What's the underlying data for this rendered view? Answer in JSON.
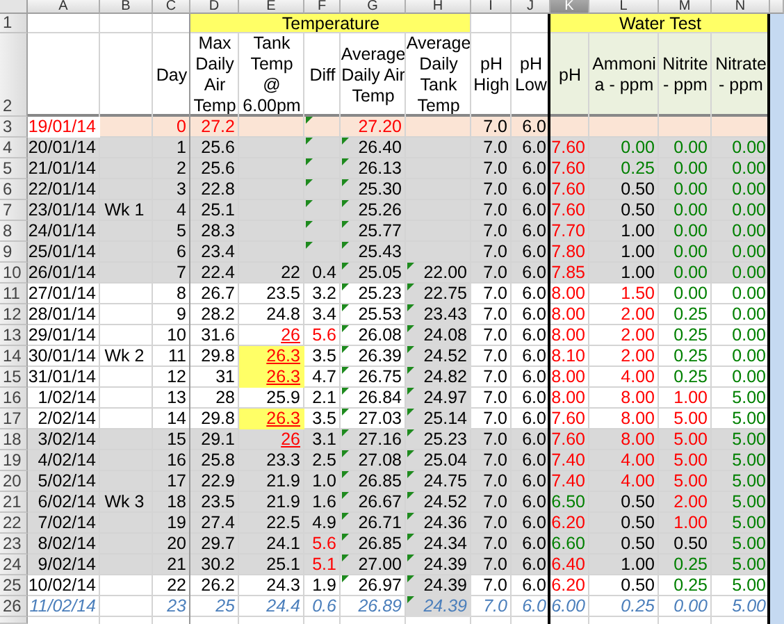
{
  "columns": [
    {
      "letter": "A",
      "selected": false,
      "shaded": false
    },
    {
      "letter": "B",
      "selected": false,
      "shaded": false
    },
    {
      "letter": "C",
      "selected": false,
      "shaded": false
    },
    {
      "letter": "D",
      "selected": false,
      "shaded": false
    },
    {
      "letter": "E",
      "selected": false,
      "shaded": false
    },
    {
      "letter": "F",
      "selected": false,
      "shaded": false
    },
    {
      "letter": "G",
      "selected": false,
      "shaded": false
    },
    {
      "letter": "H",
      "selected": false,
      "shaded": true
    },
    {
      "letter": "I",
      "selected": false,
      "shaded": false
    },
    {
      "letter": "J",
      "selected": false,
      "shaded": false
    },
    {
      "letter": "K",
      "selected": true,
      "shaded": false
    },
    {
      "letter": "L",
      "selected": false,
      "shaded": false
    },
    {
      "letter": "M",
      "selected": false,
      "shaded": false
    },
    {
      "letter": "N",
      "selected": false,
      "shaded": false
    }
  ],
  "header_rows": [
    "1",
    "2"
  ],
  "group_headers": [
    {
      "text": "Temperature"
    },
    {
      "text": "Water Test"
    }
  ],
  "headers": [
    {
      "text": "Day"
    },
    {
      "text": "Max Daily Air Temp"
    },
    {
      "text": "Tank Temp @ 6.00pm"
    },
    {
      "text": "Diff"
    },
    {
      "text": "Average Daily Air Temp"
    },
    {
      "text": "Average Daily Tank Temp"
    },
    {
      "text": "pH High"
    },
    {
      "text": "pH Low"
    },
    {
      "text": "pH"
    },
    {
      "text": "Ammoni a - ppm"
    },
    {
      "text": "Nitrite - ppm"
    },
    {
      "text": "Nitrate - ppm"
    }
  ],
  "rows": [
    {
      "number": "3",
      "kind": "baseline",
      "italic": false,
      "cells": [
        {
          "text": "19/01/14",
          "color": "#ff0000",
          "flag": false
        },
        {
          "flag": false
        },
        {
          "text": "0",
          "color": "#ff0000",
          "flag": false
        },
        {
          "text": "27.2",
          "color": "#ff0000",
          "flag": false
        },
        {
          "flag": false
        },
        {
          "flag": true
        },
        {
          "text": "27.20",
          "color": "#ff0000",
          "flag": false
        },
        {
          "flag": false
        },
        {
          "text": "7.0",
          "flag": false
        },
        {
          "text": "6.0",
          "flag": false
        },
        {
          "flag": false
        },
        {
          "flag": false
        },
        {
          "flag": false
        },
        {
          "flag": false
        }
      ]
    },
    {
      "number": "4",
      "kind": "shaded",
      "italic": false,
      "cells": [
        {
          "text": "20/01/14",
          "flag": false
        },
        {
          "flag": false
        },
        {
          "text": "1",
          "flag": false
        },
        {
          "text": "25.6",
          "flag": false
        },
        {
          "flag": false
        },
        {
          "flag": true
        },
        {
          "text": "26.40",
          "flag": true
        },
        {
          "flag": false
        },
        {
          "text": "7.0",
          "flag": false
        },
        {
          "text": "6.0",
          "flag": false
        },
        {
          "text": "7.60",
          "color": "#ff0000",
          "flag": false
        },
        {
          "text": "0.00",
          "color": "#008000",
          "flag": false
        },
        {
          "text": "0.00",
          "color": "#008000",
          "flag": false
        },
        {
          "text": "0.00",
          "color": "#008000",
          "flag": false
        }
      ]
    },
    {
      "number": "5",
      "kind": "shaded",
      "italic": false,
      "cells": [
        {
          "text": "21/01/14",
          "flag": false
        },
        {
          "flag": false
        },
        {
          "text": "2",
          "flag": false
        },
        {
          "text": "25.6",
          "flag": false
        },
        {
          "flag": false
        },
        {
          "flag": true
        },
        {
          "text": "26.13",
          "flag": true
        },
        {
          "flag": false
        },
        {
          "text": "7.0",
          "flag": false
        },
        {
          "text": "6.0",
          "flag": false
        },
        {
          "text": "7.60",
          "color": "#ff0000",
          "flag": false
        },
        {
          "text": "0.25",
          "color": "#008000",
          "flag": false
        },
        {
          "text": "0.00",
          "color": "#008000",
          "flag": false
        },
        {
          "text": "0.00",
          "color": "#008000",
          "flag": false
        }
      ]
    },
    {
      "number": "6",
      "kind": "shaded",
      "italic": false,
      "cells": [
        {
          "text": "22/01/14",
          "flag": false
        },
        {
          "flag": false
        },
        {
          "text": "3",
          "flag": false
        },
        {
          "text": "22.8",
          "flag": false
        },
        {
          "flag": false
        },
        {
          "flag": true
        },
        {
          "text": "25.30",
          "flag": true
        },
        {
          "flag": false
        },
        {
          "text": "7.0",
          "flag": false
        },
        {
          "text": "6.0",
          "flag": false
        },
        {
          "text": "7.60",
          "color": "#ff0000",
          "flag": false
        },
        {
          "text": "0.50",
          "flag": false
        },
        {
          "text": "0.00",
          "color": "#008000",
          "flag": false
        },
        {
          "text": "0.00",
          "color": "#008000",
          "flag": false
        }
      ]
    },
    {
      "number": "7",
      "kind": "shaded",
      "italic": false,
      "cells": [
        {
          "text": "23/01/14",
          "flag": false
        },
        {
          "text": "Wk 1",
          "flag": false
        },
        {
          "text": "4",
          "flag": false
        },
        {
          "text": "25.1",
          "flag": false
        },
        {
          "flag": false
        },
        {
          "flag": true
        },
        {
          "text": "25.26",
          "flag": true
        },
        {
          "flag": false
        },
        {
          "text": "7.0",
          "flag": false
        },
        {
          "text": "6.0",
          "flag": false
        },
        {
          "text": "7.60",
          "color": "#ff0000",
          "flag": false
        },
        {
          "text": "0.50",
          "flag": false
        },
        {
          "text": "0.00",
          "color": "#008000",
          "flag": false
        },
        {
          "text": "0.00",
          "color": "#008000",
          "flag": false
        }
      ]
    },
    {
      "number": "8",
      "kind": "shaded",
      "italic": false,
      "cells": [
        {
          "text": "24/01/14",
          "flag": false
        },
        {
          "flag": false
        },
        {
          "text": "5",
          "flag": false
        },
        {
          "text": "28.3",
          "flag": false
        },
        {
          "flag": false
        },
        {
          "flag": true
        },
        {
          "text": "25.77",
          "flag": true
        },
        {
          "flag": false
        },
        {
          "text": "7.0",
          "flag": false
        },
        {
          "text": "6.0",
          "flag": false
        },
        {
          "text": "7.70",
          "color": "#ff0000",
          "flag": false
        },
        {
          "text": "1.00",
          "flag": false
        },
        {
          "text": "0.00",
          "color": "#008000",
          "flag": false
        },
        {
          "text": "0.00",
          "color": "#008000",
          "flag": false
        }
      ]
    },
    {
      "number": "9",
      "kind": "shaded",
      "italic": false,
      "cells": [
        {
          "text": "25/01/14",
          "flag": false
        },
        {
          "flag": false
        },
        {
          "text": "6",
          "flag": false
        },
        {
          "text": "23.4",
          "flag": false
        },
        {
          "flag": false
        },
        {
          "flag": true
        },
        {
          "text": "25.43",
          "flag": true
        },
        {
          "flag": false
        },
        {
          "text": "7.0",
          "flag": false
        },
        {
          "text": "6.0",
          "flag": false
        },
        {
          "text": "7.80",
          "color": "#ff0000",
          "flag": false
        },
        {
          "text": "1.00",
          "flag": false
        },
        {
          "text": "0.00",
          "color": "#008000",
          "flag": false
        },
        {
          "text": "0.00",
          "color": "#008000",
          "flag": false
        }
      ]
    },
    {
      "number": "10",
      "kind": "shaded",
      "italic": false,
      "cells": [
        {
          "text": "26/01/14",
          "flag": false
        },
        {
          "flag": false
        },
        {
          "text": "7",
          "flag": false
        },
        {
          "text": "22.4",
          "flag": false
        },
        {
          "text": "22",
          "flag": false
        },
        {
          "text": "0.4",
          "flag": false
        },
        {
          "text": "25.05",
          "flag": true
        },
        {
          "text": "22.00",
          "flag": true
        },
        {
          "text": "7.0",
          "flag": false
        },
        {
          "text": "6.0",
          "flag": false
        },
        {
          "text": "7.85",
          "color": "#ff0000",
          "flag": false
        },
        {
          "text": "1.00",
          "flag": false
        },
        {
          "text": "0.00",
          "color": "#008000",
          "flag": false
        },
        {
          "text": "0.00",
          "color": "#008000",
          "flag": false
        }
      ]
    },
    {
      "number": "11",
      "kind": "plain",
      "italic": false,
      "cells": [
        {
          "text": "27/01/14",
          "flag": false
        },
        {
          "flag": false
        },
        {
          "text": "8",
          "flag": false
        },
        {
          "text": "26.7",
          "flag": false
        },
        {
          "text": "23.5",
          "flag": false
        },
        {
          "text": "3.2",
          "flag": false
        },
        {
          "text": "25.23",
          "flag": true
        },
        {
          "text": "22.75",
          "flag": true
        },
        {
          "text": "7.0",
          "flag": false
        },
        {
          "text": "6.0",
          "flag": false
        },
        {
          "text": "8.00",
          "color": "#ff0000",
          "flag": false
        },
        {
          "text": "1.50",
          "color": "#ff0000",
          "flag": false
        },
        {
          "text": "0.00",
          "color": "#008000",
          "flag": false
        },
        {
          "text": "0.00",
          "color": "#008000",
          "flag": false
        }
      ]
    },
    {
      "number": "12",
      "kind": "plain",
      "italic": false,
      "cells": [
        {
          "text": "28/01/14",
          "flag": false
        },
        {
          "flag": false
        },
        {
          "text": "9",
          "flag": false
        },
        {
          "text": "28.2",
          "flag": false
        },
        {
          "text": "24.8",
          "flag": false
        },
        {
          "text": "3.4",
          "flag": false
        },
        {
          "text": "25.53",
          "flag": true
        },
        {
          "text": "23.43",
          "flag": true
        },
        {
          "text": "7.0",
          "flag": false
        },
        {
          "text": "6.0",
          "flag": false
        },
        {
          "text": "8.00",
          "color": "#ff0000",
          "flag": false
        },
        {
          "text": "2.00",
          "color": "#ff0000",
          "flag": false
        },
        {
          "text": "0.25",
          "color": "#008000",
          "flag": false
        },
        {
          "text": "0.00",
          "color": "#008000",
          "flag": false
        }
      ]
    },
    {
      "number": "13",
      "kind": "plain",
      "italic": false,
      "cells": [
        {
          "text": "29/01/14",
          "flag": false
        },
        {
          "flag": false
        },
        {
          "text": "10",
          "flag": false
        },
        {
          "text": "31.6",
          "flag": false
        },
        {
          "text": "26",
          "color": "#ff0000",
          "underline": true,
          "flag": false
        },
        {
          "text": "5.6",
          "color": "#ff0000",
          "flag": false
        },
        {
          "text": "26.08",
          "flag": true
        },
        {
          "text": "24.08",
          "flag": true
        },
        {
          "text": "7.0",
          "flag": false
        },
        {
          "text": "6.0",
          "flag": false
        },
        {
          "text": "8.00",
          "color": "#ff0000",
          "flag": false
        },
        {
          "text": "2.00",
          "color": "#ff0000",
          "flag": false
        },
        {
          "text": "0.25",
          "color": "#008000",
          "flag": false
        },
        {
          "text": "0.00",
          "color": "#008000",
          "flag": false
        }
      ]
    },
    {
      "number": "14",
      "kind": "plain",
      "italic": false,
      "cells": [
        {
          "text": "30/01/14",
          "flag": false
        },
        {
          "text": "Wk 2",
          "flag": false
        },
        {
          "text": "11",
          "flag": false
        },
        {
          "text": "29.8",
          "flag": false
        },
        {
          "text": "26.3",
          "color": "#ff0000",
          "underline": true,
          "highlighted": true,
          "flag": false
        },
        {
          "text": "3.5",
          "flag": false
        },
        {
          "text": "26.39",
          "flag": true
        },
        {
          "text": "24.52",
          "flag": true
        },
        {
          "text": "7.0",
          "flag": false
        },
        {
          "text": "6.0",
          "flag": false
        },
        {
          "text": "8.10",
          "color": "#ff0000",
          "flag": false
        },
        {
          "text": "2.00",
          "color": "#ff0000",
          "flag": false
        },
        {
          "text": "0.25",
          "color": "#008000",
          "flag": false
        },
        {
          "text": "0.00",
          "color": "#008000",
          "flag": false
        }
      ]
    },
    {
      "number": "15",
      "kind": "plain",
      "italic": false,
      "cells": [
        {
          "text": "31/01/14",
          "flag": false
        },
        {
          "flag": false
        },
        {
          "text": "12",
          "flag": false
        },
        {
          "text": "31",
          "flag": false
        },
        {
          "text": "26.3",
          "color": "#ff0000",
          "underline": true,
          "highlighted": true,
          "flag": false
        },
        {
          "text": "4.7",
          "flag": false
        },
        {
          "text": "26.75",
          "flag": true
        },
        {
          "text": "24.82",
          "flag": true
        },
        {
          "text": "7.0",
          "flag": false
        },
        {
          "text": "6.0",
          "flag": false
        },
        {
          "text": "8.00",
          "color": "#ff0000",
          "flag": false
        },
        {
          "text": "4.00",
          "color": "#ff0000",
          "flag": false
        },
        {
          "text": "0.25",
          "color": "#008000",
          "flag": false
        },
        {
          "text": "0.00",
          "color": "#008000",
          "flag": false
        }
      ]
    },
    {
      "number": "16",
      "kind": "plain",
      "italic": false,
      "cells": [
        {
          "text": "1/02/14",
          "flag": false
        },
        {
          "flag": false
        },
        {
          "text": "13",
          "flag": false
        },
        {
          "text": "28",
          "flag": false
        },
        {
          "text": "25.9",
          "flag": false
        },
        {
          "text": "2.1",
          "flag": false
        },
        {
          "text": "26.84",
          "flag": true
        },
        {
          "text": "24.97",
          "flag": true
        },
        {
          "text": "7.0",
          "flag": false
        },
        {
          "text": "6.0",
          "flag": false
        },
        {
          "text": "8.00",
          "color": "#ff0000",
          "flag": false
        },
        {
          "text": "8.00",
          "color": "#ff0000",
          "flag": false
        },
        {
          "text": "1.00",
          "color": "#ff0000",
          "flag": false
        },
        {
          "text": "5.00",
          "color": "#008000",
          "flag": false
        }
      ]
    },
    {
      "number": "17",
      "kind": "plain",
      "italic": false,
      "cells": [
        {
          "text": "2/02/14",
          "flag": false
        },
        {
          "flag": false
        },
        {
          "text": "14",
          "flag": false
        },
        {
          "text": "29.8",
          "flag": false
        },
        {
          "text": "26.3",
          "color": "#ff0000",
          "underline": true,
          "highlighted": true,
          "flag": false
        },
        {
          "text": "3.5",
          "flag": false
        },
        {
          "text": "27.03",
          "flag": true
        },
        {
          "text": "25.14",
          "flag": true
        },
        {
          "text": "7.0",
          "flag": false
        },
        {
          "text": "6.0",
          "flag": false
        },
        {
          "text": "7.60",
          "color": "#ff0000",
          "flag": false
        },
        {
          "text": "8.00",
          "color": "#ff0000",
          "flag": false
        },
        {
          "text": "5.00",
          "color": "#ff0000",
          "flag": false
        },
        {
          "text": "5.00",
          "color": "#008000",
          "flag": false
        }
      ]
    },
    {
      "number": "18",
      "kind": "shaded",
      "italic": false,
      "cells": [
        {
          "text": "3/02/14",
          "flag": false
        },
        {
          "flag": false
        },
        {
          "text": "15",
          "flag": false
        },
        {
          "text": "29.1",
          "flag": false
        },
        {
          "text": "26",
          "color": "#ff0000",
          "underline": true,
          "flag": false
        },
        {
          "text": "3.1",
          "flag": false
        },
        {
          "text": "27.16",
          "flag": true
        },
        {
          "text": "25.23",
          "flag": true
        },
        {
          "text": "7.0",
          "flag": false
        },
        {
          "text": "6.0",
          "flag": false
        },
        {
          "text": "7.60",
          "color": "#ff0000",
          "flag": false
        },
        {
          "text": "8.00",
          "color": "#ff0000",
          "flag": false
        },
        {
          "text": "5.00",
          "color": "#ff0000",
          "flag": false
        },
        {
          "text": "5.00",
          "color": "#008000",
          "flag": false
        }
      ]
    },
    {
      "number": "19",
      "kind": "shaded",
      "italic": false,
      "cells": [
        {
          "text": "4/02/14",
          "flag": false
        },
        {
          "flag": false
        },
        {
          "text": "16",
          "flag": false
        },
        {
          "text": "25.8",
          "flag": false
        },
        {
          "text": "23.3",
          "flag": false
        },
        {
          "text": "2.5",
          "flag": false
        },
        {
          "text": "27.08",
          "flag": true
        },
        {
          "text": "25.04",
          "flag": true
        },
        {
          "text": "7.0",
          "flag": false
        },
        {
          "text": "6.0",
          "flag": false
        },
        {
          "text": "7.40",
          "color": "#ff0000",
          "flag": false
        },
        {
          "text": "4.00",
          "color": "#ff0000",
          "flag": false
        },
        {
          "text": "5.00",
          "color": "#ff0000",
          "flag": false
        },
        {
          "text": "5.00",
          "color": "#008000",
          "flag": false
        }
      ]
    },
    {
      "number": "20",
      "kind": "shaded",
      "italic": false,
      "cells": [
        {
          "text": "5/02/14",
          "flag": false
        },
        {
          "flag": false
        },
        {
          "text": "17",
          "flag": false
        },
        {
          "text": "22.9",
          "flag": false
        },
        {
          "text": "21.9",
          "flag": false
        },
        {
          "text": "1.0",
          "flag": false
        },
        {
          "text": "26.85",
          "flag": true
        },
        {
          "text": "24.75",
          "flag": true
        },
        {
          "text": "7.0",
          "flag": false
        },
        {
          "text": "6.0",
          "flag": false
        },
        {
          "text": "7.40",
          "color": "#ff0000",
          "flag": false
        },
        {
          "text": "4.00",
          "color": "#ff0000",
          "flag": false
        },
        {
          "text": "5.00",
          "color": "#ff0000",
          "flag": false
        },
        {
          "text": "5.00",
          "color": "#008000",
          "flag": false
        }
      ]
    },
    {
      "number": "21",
      "kind": "shaded",
      "italic": false,
      "cells": [
        {
          "text": "6/02/14",
          "flag": false
        },
        {
          "text": "Wk 3",
          "flag": false
        },
        {
          "text": "18",
          "flag": false
        },
        {
          "text": "23.5",
          "flag": false
        },
        {
          "text": "21.9",
          "flag": false
        },
        {
          "text": "1.6",
          "flag": false
        },
        {
          "text": "26.67",
          "flag": true
        },
        {
          "text": "24.52",
          "flag": true
        },
        {
          "text": "7.0",
          "flag": false
        },
        {
          "text": "6.0",
          "flag": false
        },
        {
          "text": "6.50",
          "color": "#008000",
          "flag": false
        },
        {
          "text": "0.50",
          "flag": false
        },
        {
          "text": "2.00",
          "color": "#ff0000",
          "flag": false
        },
        {
          "text": "5.00",
          "color": "#008000",
          "flag": false
        }
      ]
    },
    {
      "number": "22",
      "kind": "shaded",
      "italic": false,
      "cells": [
        {
          "text": "7/02/14",
          "flag": false
        },
        {
          "flag": false
        },
        {
          "text": "19",
          "flag": false
        },
        {
          "text": "27.4",
          "flag": false
        },
        {
          "text": "22.5",
          "flag": false
        },
        {
          "text": "4.9",
          "flag": false
        },
        {
          "text": "26.71",
          "flag": true
        },
        {
          "text": "24.36",
          "flag": true
        },
        {
          "text": "7.0",
          "flag": false
        },
        {
          "text": "6.0",
          "flag": false
        },
        {
          "text": "6.20",
          "color": "#ff0000",
          "flag": false
        },
        {
          "text": "0.50",
          "flag": false
        },
        {
          "text": "1.00",
          "color": "#ff0000",
          "flag": false
        },
        {
          "text": "5.00",
          "color": "#008000",
          "flag": false
        }
      ]
    },
    {
      "number": "23",
      "kind": "shaded",
      "italic": false,
      "cells": [
        {
          "text": "8/02/14",
          "flag": false
        },
        {
          "flag": false
        },
        {
          "text": "20",
          "flag": false
        },
        {
          "text": "29.7",
          "flag": false
        },
        {
          "text": "24.1",
          "flag": false
        },
        {
          "text": "5.6",
          "color": "#ff0000",
          "flag": false
        },
        {
          "text": "26.85",
          "flag": true
        },
        {
          "text": "24.34",
          "flag": true
        },
        {
          "text": "7.0",
          "flag": false
        },
        {
          "text": "6.0",
          "flag": false
        },
        {
          "text": "6.60",
          "color": "#008000",
          "flag": false
        },
        {
          "text": "0.50",
          "flag": false
        },
        {
          "text": "0.50",
          "flag": false
        },
        {
          "text": "5.00",
          "color": "#008000",
          "flag": false
        }
      ]
    },
    {
      "number": "24",
      "kind": "shaded",
      "italic": false,
      "cells": [
        {
          "text": "9/02/14",
          "flag": false
        },
        {
          "flag": false
        },
        {
          "text": "21",
          "flag": false
        },
        {
          "text": "30.2",
          "flag": false
        },
        {
          "text": "25.1",
          "flag": false
        },
        {
          "text": "5.1",
          "color": "#ff0000",
          "flag": false
        },
        {
          "text": "27.00",
          "flag": true
        },
        {
          "text": "24.39",
          "flag": true
        },
        {
          "text": "7.0",
          "flag": false
        },
        {
          "text": "6.0",
          "flag": false
        },
        {
          "text": "6.40",
          "color": "#ff0000",
          "flag": false
        },
        {
          "text": "1.00",
          "flag": false
        },
        {
          "text": "0.25",
          "color": "#008000",
          "flag": false
        },
        {
          "text": "5.00",
          "color": "#008000",
          "flag": false
        }
      ]
    },
    {
      "number": "25",
      "kind": "plain",
      "italic": false,
      "cells": [
        {
          "text": "10/02/14",
          "flag": false
        },
        {
          "flag": false
        },
        {
          "text": "22",
          "flag": false
        },
        {
          "text": "26.2",
          "flag": false
        },
        {
          "text": "24.3",
          "flag": false
        },
        {
          "text": "1.9",
          "flag": false
        },
        {
          "text": "26.97",
          "flag": true
        },
        {
          "text": "24.39",
          "flag": true
        },
        {
          "text": "7.0",
          "flag": false
        },
        {
          "text": "6.0",
          "flag": false
        },
        {
          "text": "6.20",
          "color": "#ff0000",
          "flag": false
        },
        {
          "text": "0.50",
          "flag": false
        },
        {
          "text": "0.25",
          "color": "#008000",
          "flag": false
        },
        {
          "text": "5.00",
          "color": "#008000",
          "flag": false
        }
      ]
    },
    {
      "number": "26",
      "kind": "plain",
      "italic": true,
      "cells": [
        {
          "text": "11/02/14",
          "color": "#4a7ebb",
          "flag": false
        },
        {
          "flag": false
        },
        {
          "text": "23",
          "color": "#4a7ebb",
          "flag": false
        },
        {
          "text": "25",
          "color": "#4a7ebb",
          "flag": false
        },
        {
          "text": "24.4",
          "color": "#4a7ebb",
          "flag": false
        },
        {
          "text": "0.6",
          "color": "#4a7ebb",
          "flag": false
        },
        {
          "text": "26.89",
          "color": "#4a7ebb",
          "flag": false
        },
        {
          "text": "24.39",
          "color": "#4a7ebb",
          "flag": true
        },
        {
          "text": "7.0",
          "color": "#4a7ebb",
          "flag": false
        },
        {
          "text": "6.0",
          "color": "#4a7ebb",
          "flag": false
        },
        {
          "text": "6.00",
          "color": "#4a7ebb",
          "flag": false
        },
        {
          "text": "0.25",
          "color": "#4a7ebb",
          "flag": false
        },
        {
          "text": "0.00",
          "color": "#4a7ebb",
          "flag": false
        },
        {
          "text": "5.00",
          "color": "#4a7ebb",
          "flag": false
        }
      ]
    }
  ]
}
